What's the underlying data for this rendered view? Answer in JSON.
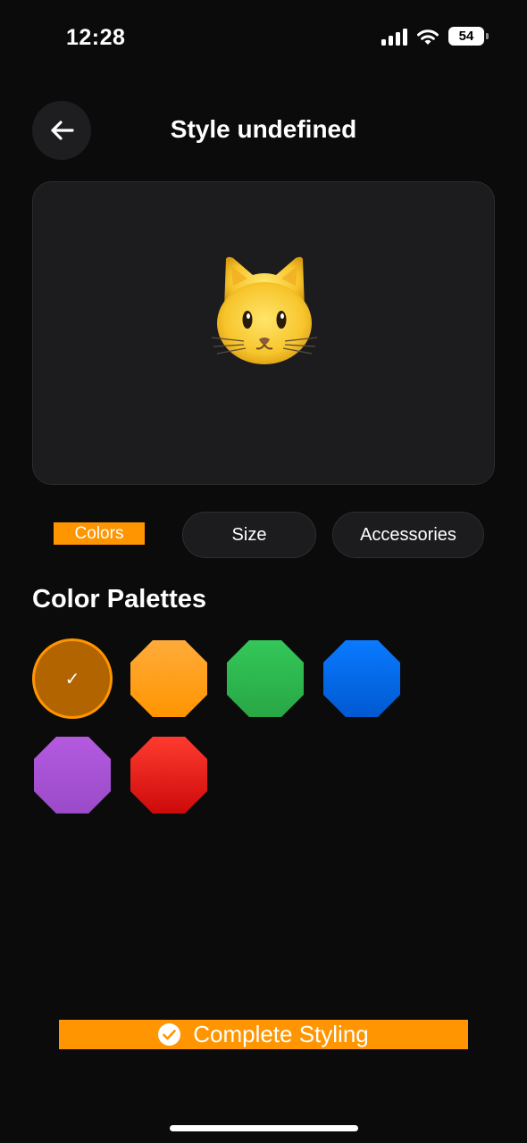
{
  "status_bar": {
    "time": "12:28",
    "battery_level": "54",
    "icons": [
      "signal-icon",
      "wifi-icon",
      "battery-icon"
    ]
  },
  "header": {
    "title": "Style undefined",
    "back_icon": "arrow-left-icon"
  },
  "preview": {
    "emoji": "cat-face"
  },
  "tabs": [
    {
      "label": "Colors",
      "active": true
    },
    {
      "label": "Size",
      "active": false
    },
    {
      "label": "Accessories",
      "active": false
    }
  ],
  "palettes": {
    "title": "Color Palettes",
    "selected_index": 0,
    "items": [
      {
        "color": "#b16400",
        "selected": true
      },
      {
        "color": "#ff9f0a",
        "selected": false
      },
      {
        "color": "#30b84f",
        "selected": false
      },
      {
        "color": "#0a6cf0",
        "selected": false
      },
      {
        "color": "#a850d8",
        "selected": false
      },
      {
        "color": "#e0141a",
        "selected": false
      }
    ],
    "check_icon": "checkmark-icon"
  },
  "footer": {
    "complete_label": "Complete Styling",
    "icon": "check-circle-icon"
  },
  "colors": {
    "accent": "#ff9500",
    "background": "#0b0b0b",
    "card": "#1c1c1e"
  }
}
